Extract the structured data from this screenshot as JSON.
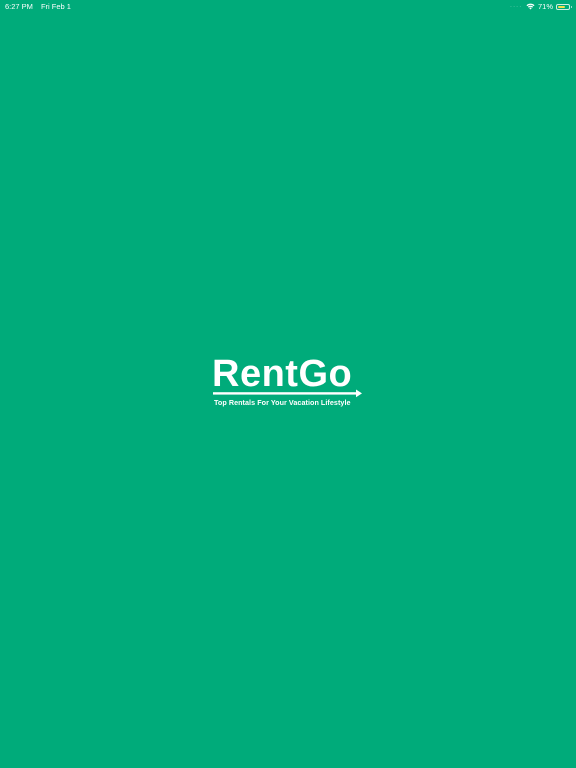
{
  "status_bar": {
    "time": "6:27 PM",
    "date": "Fri Feb 1",
    "battery_percent": "71%",
    "battery_level": 0.71,
    "icons": [
      "wifi-icon",
      "battery-icon"
    ]
  },
  "splash": {
    "logo_text": "RentGo",
    "tagline": "Top Rentals For Your Vacation Lifestyle",
    "background_color": "#00ab7a",
    "foreground_color": "#ffffff"
  }
}
